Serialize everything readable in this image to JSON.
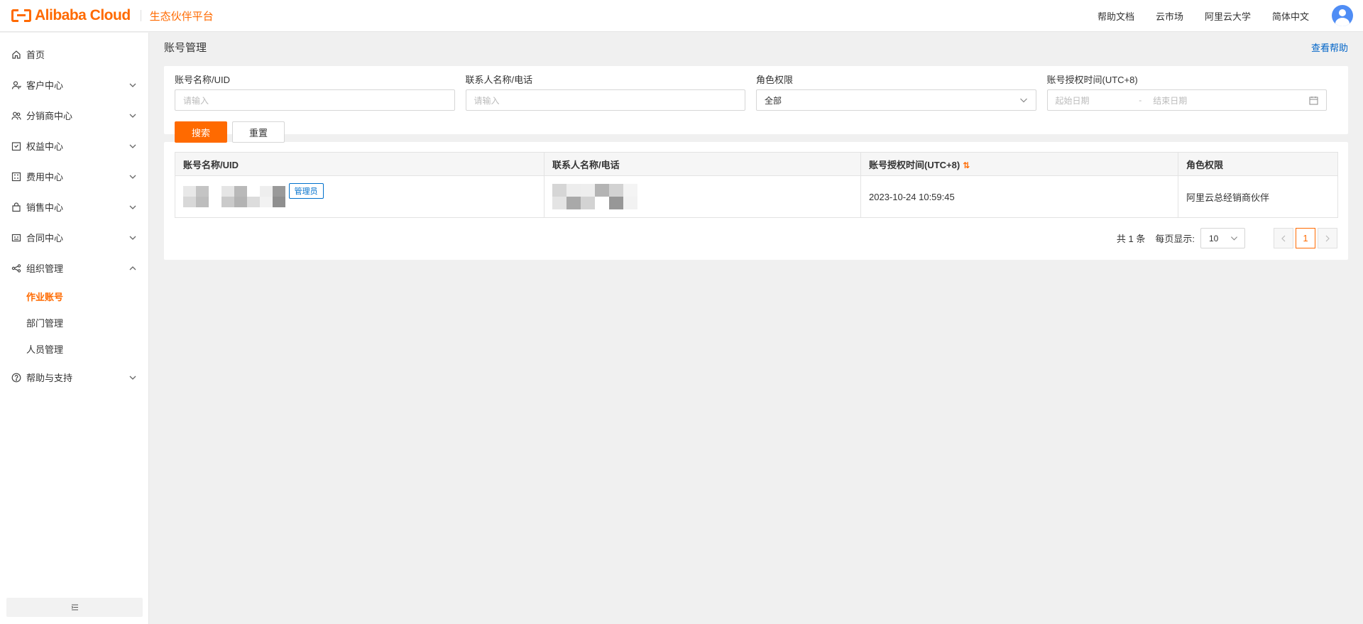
{
  "header": {
    "brand": "Alibaba Cloud",
    "platform": "生态伙伴平台",
    "nav": [
      "帮助文档",
      "云市场",
      "阿里云大学",
      "简体中文"
    ]
  },
  "sidebar": {
    "items": [
      {
        "label": "首页",
        "icon": "home-icon"
      },
      {
        "label": "客户中心",
        "icon": "customer-icon"
      },
      {
        "label": "分销商中心",
        "icon": "distributor-icon"
      },
      {
        "label": "权益中心",
        "icon": "rights-icon"
      },
      {
        "label": "费用中心",
        "icon": "billing-icon"
      },
      {
        "label": "销售中心",
        "icon": "sales-icon"
      },
      {
        "label": "合同中心",
        "icon": "contract-icon"
      },
      {
        "label": "组织管理",
        "icon": "org-icon"
      }
    ],
    "org_subitems": [
      "作业账号",
      "部门管理",
      "人员管理"
    ],
    "support": {
      "label": "帮助与支持",
      "icon": "help-circle-icon"
    }
  },
  "page": {
    "title": "账号管理",
    "help": "查看帮助"
  },
  "filters": {
    "account_label": "账号名称/UID",
    "account_placeholder": "请输入",
    "contact_label": "联系人名称/电话",
    "contact_placeholder": "请输入",
    "role_label": "角色权限",
    "role_value": "全部",
    "time_label": "账号授权时间(UTC+8)",
    "start_placeholder": "起始日期",
    "end_placeholder": "结束日期",
    "range_sep": "-",
    "search_btn": "搜索",
    "reset_btn": "重置"
  },
  "table": {
    "columns": [
      "账号名称/UID",
      "联系人名称/电话",
      "账号授权时间(UTC+8)",
      "角色权限"
    ],
    "rows": [
      {
        "badge": "管理员",
        "time": "2023-10-24 10:59:45",
        "role": "阿里云总经销商伙伴"
      }
    ]
  },
  "pagination": {
    "total": "共 1 条",
    "per_page_label": "每页显示:",
    "per_page": "10",
    "current": "1"
  },
  "colors": {
    "accent": "#ff6a00",
    "link": "#0064c8"
  }
}
